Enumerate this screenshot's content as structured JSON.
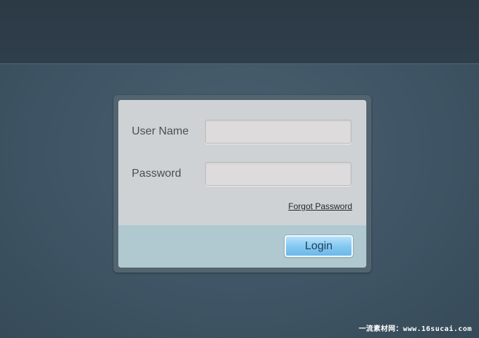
{
  "login": {
    "username_label": "User Name",
    "username_value": "",
    "password_label": "Password",
    "password_value": "",
    "forgot_link": "Forgot Password",
    "submit_label": "Login"
  },
  "watermark": {
    "text": "一流素材网：www.16sucai.com"
  },
  "colors": {
    "background": "#3e5463",
    "top_band": "#2e3c48",
    "card_body": "#cfd2d5",
    "card_footer": "#b0c9d0",
    "button_accent": "#86c9f1"
  }
}
